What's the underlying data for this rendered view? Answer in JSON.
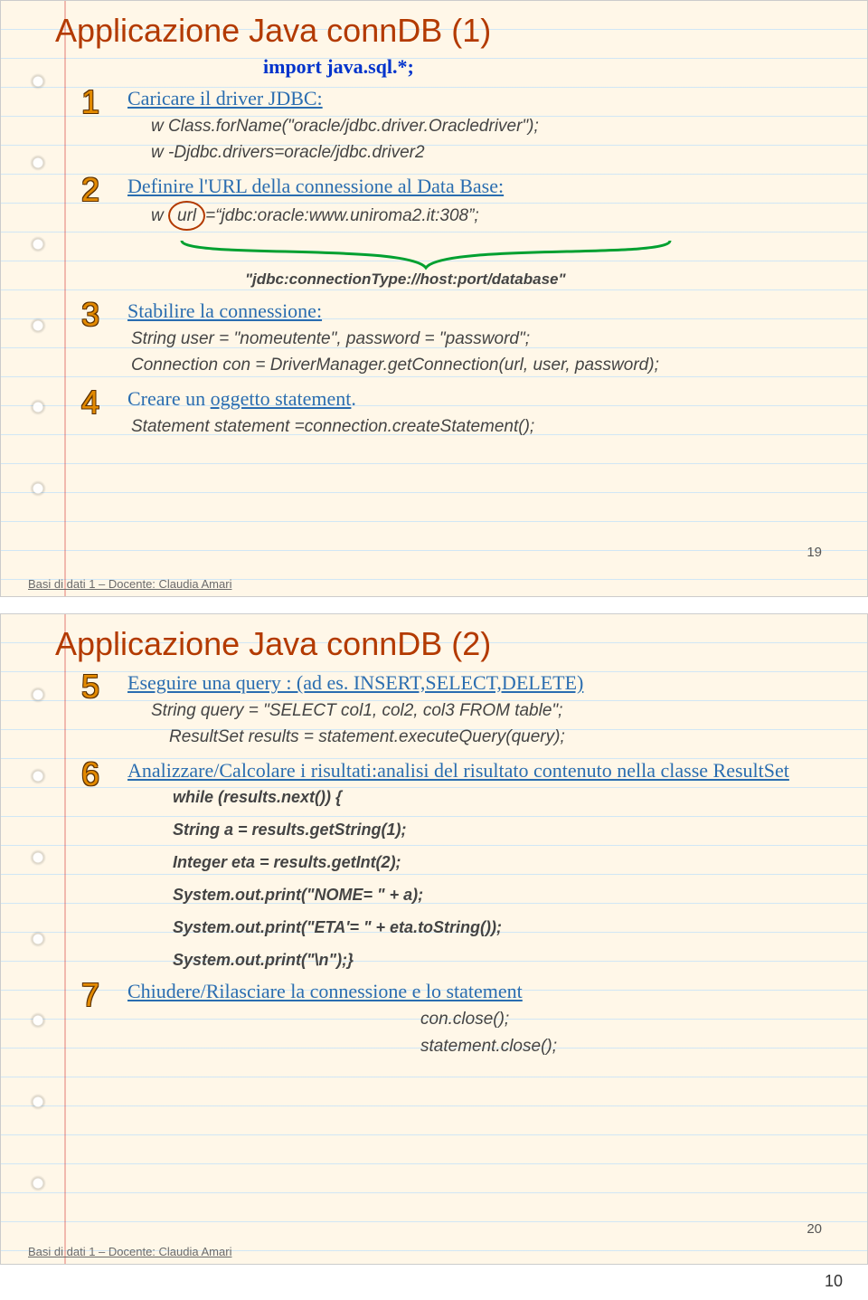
{
  "slide1": {
    "title": "Applicazione Java connDB (1)",
    "import": "import java.sql.*;",
    "step1": {
      "label": "Caricare il driver JDBC:",
      "line1": "w Class.forName(\"oracle/jdbc.driver.Oracledriver\");",
      "line2": "w -Djdbc.drivers=oracle/jdbc.driver2"
    },
    "step2": {
      "label": "Definire l'URL della connessione al Data Base:",
      "line1": "w url=\"jdbc:oracle:www.uniroma2.it:308\";"
    },
    "annot": "\"jdbc:connectionType://host:port/database\"",
    "step3": {
      "label": "Stabilire la connessione:",
      "line1": "String user = \"nomeutente\", password = \"password\";",
      "line2": "Connection con = DriverManager.getConnection(url, user, password);"
    },
    "step4": {
      "label": "Creare un oggetto statement.",
      "line1": "Statement statement =connection.createStatement();"
    },
    "footer": "Basi di dati 1 – Docente: Claudia Amari",
    "pagenum": "19"
  },
  "slide2": {
    "title": "Applicazione Java connDB (2)",
    "step5": {
      "label": "Eseguire una query : (ad es. INSERT,SELECT,DELETE)",
      "line1": "String query = \"SELECT col1, col2, col3 FROM table\";",
      "line2": "ResultSet results = statement.executeQuery(query);"
    },
    "step6": {
      "label": "Analizzare/Calcolare i risultati:analisi del risultato contenuto nella classe ResultSet",
      "c1": "while (results.next()) {",
      "c2": "String a = results.getString(1);",
      "c3": "Integer eta = results.getInt(2);",
      "c4": "System.out.print(\"NOME= \" + a);",
      "c5": "System.out.print(\"ETA'= \" + eta.toString());",
      "c6": "System.out.print(\"\\n\");}"
    },
    "step7": {
      "label": "Chiudere/Rilasciare la connessione e lo statement",
      "line1": "con.close();",
      "line2": "statement.close();"
    },
    "footer": "Basi di dati 1 – Docente: Claudia Amari",
    "pagenum": "20"
  },
  "sheet_page": "10"
}
